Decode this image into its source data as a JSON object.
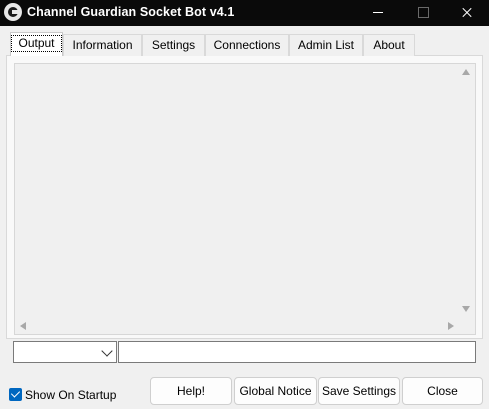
{
  "window": {
    "title": "Channel Guardian Socket Bot v4.1"
  },
  "tabs": [
    {
      "label": "Output",
      "active": true
    },
    {
      "label": "Information",
      "active": false
    },
    {
      "label": "Settings",
      "active": false
    },
    {
      "label": "Connections",
      "active": false
    },
    {
      "label": "Admin List",
      "active": false
    },
    {
      "label": "About",
      "active": false
    }
  ],
  "output": {
    "text": ""
  },
  "command": {
    "combo_value": "",
    "input_value": ""
  },
  "startup": {
    "label": "Show On Startup",
    "checked": true
  },
  "buttons": {
    "help": "Help!",
    "global_notice": "Global Notice",
    "save_settings": "Save Settings",
    "close": "Close"
  },
  "colors": {
    "titlebar": "#0a0a0a",
    "background": "#f0f0f0",
    "accent": "#0067c0"
  }
}
